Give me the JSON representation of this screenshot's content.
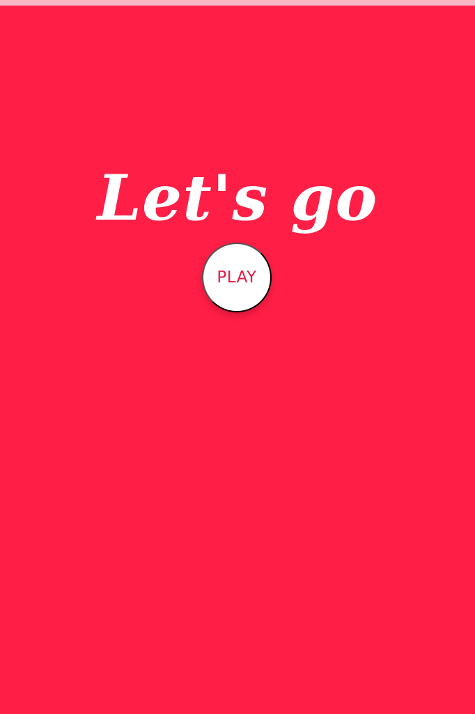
{
  "screen": {
    "title": "Let's go",
    "play_button_label": "PLAY"
  },
  "colors": {
    "background": "#ff1e46",
    "status_strip": "#f7b8c5",
    "button_background": "#ffffff",
    "button_text": "#e71a45",
    "title_text": "#ffffff"
  }
}
